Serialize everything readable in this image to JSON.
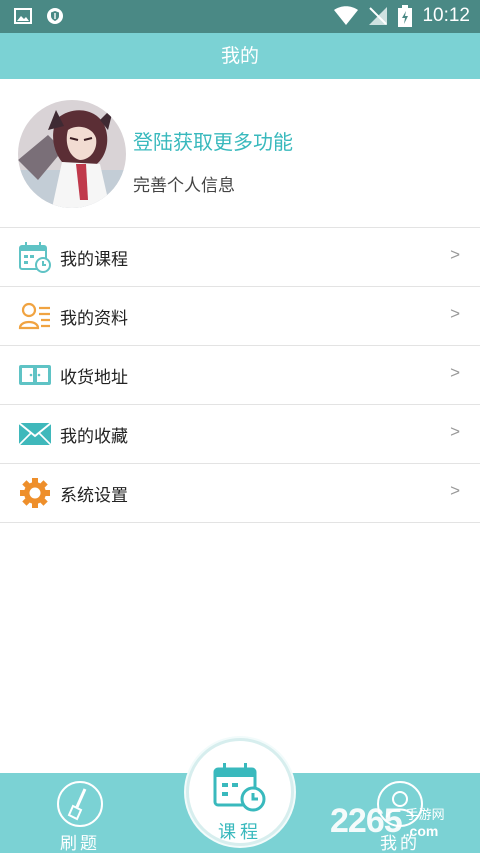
{
  "status_bar": {
    "time": "10:12"
  },
  "header": {
    "title": "我的"
  },
  "profile": {
    "title": "登陆获取更多功能",
    "subtitle": "完善个人信息"
  },
  "menu": {
    "items": [
      {
        "label": "我的课程",
        "arrow": ">",
        "icon": "course-calendar-icon"
      },
      {
        "label": "我的资料",
        "arrow": ">",
        "icon": "profile-info-icon"
      },
      {
        "label": "收货地址",
        "arrow": ">",
        "icon": "address-icon"
      },
      {
        "label": "我的收藏",
        "arrow": ">",
        "icon": "envelope-icon"
      },
      {
        "label": "系统设置",
        "arrow": ">",
        "icon": "gear-icon"
      }
    ]
  },
  "tabbar": {
    "left": {
      "label": "刷题",
      "icon": "brush-icon"
    },
    "center": {
      "label": "课程",
      "icon": "calendar-clock-icon"
    },
    "right": {
      "label": "我的",
      "icon": "user-icon"
    }
  },
  "watermark": {
    "num": "2265",
    "text_a": "手游网",
    "text_b": ".com"
  },
  "colors": {
    "teal": "#7bd2d4",
    "accent": "#39b9bd",
    "statusbar": "#4a8985",
    "orange": "#f0a341"
  }
}
